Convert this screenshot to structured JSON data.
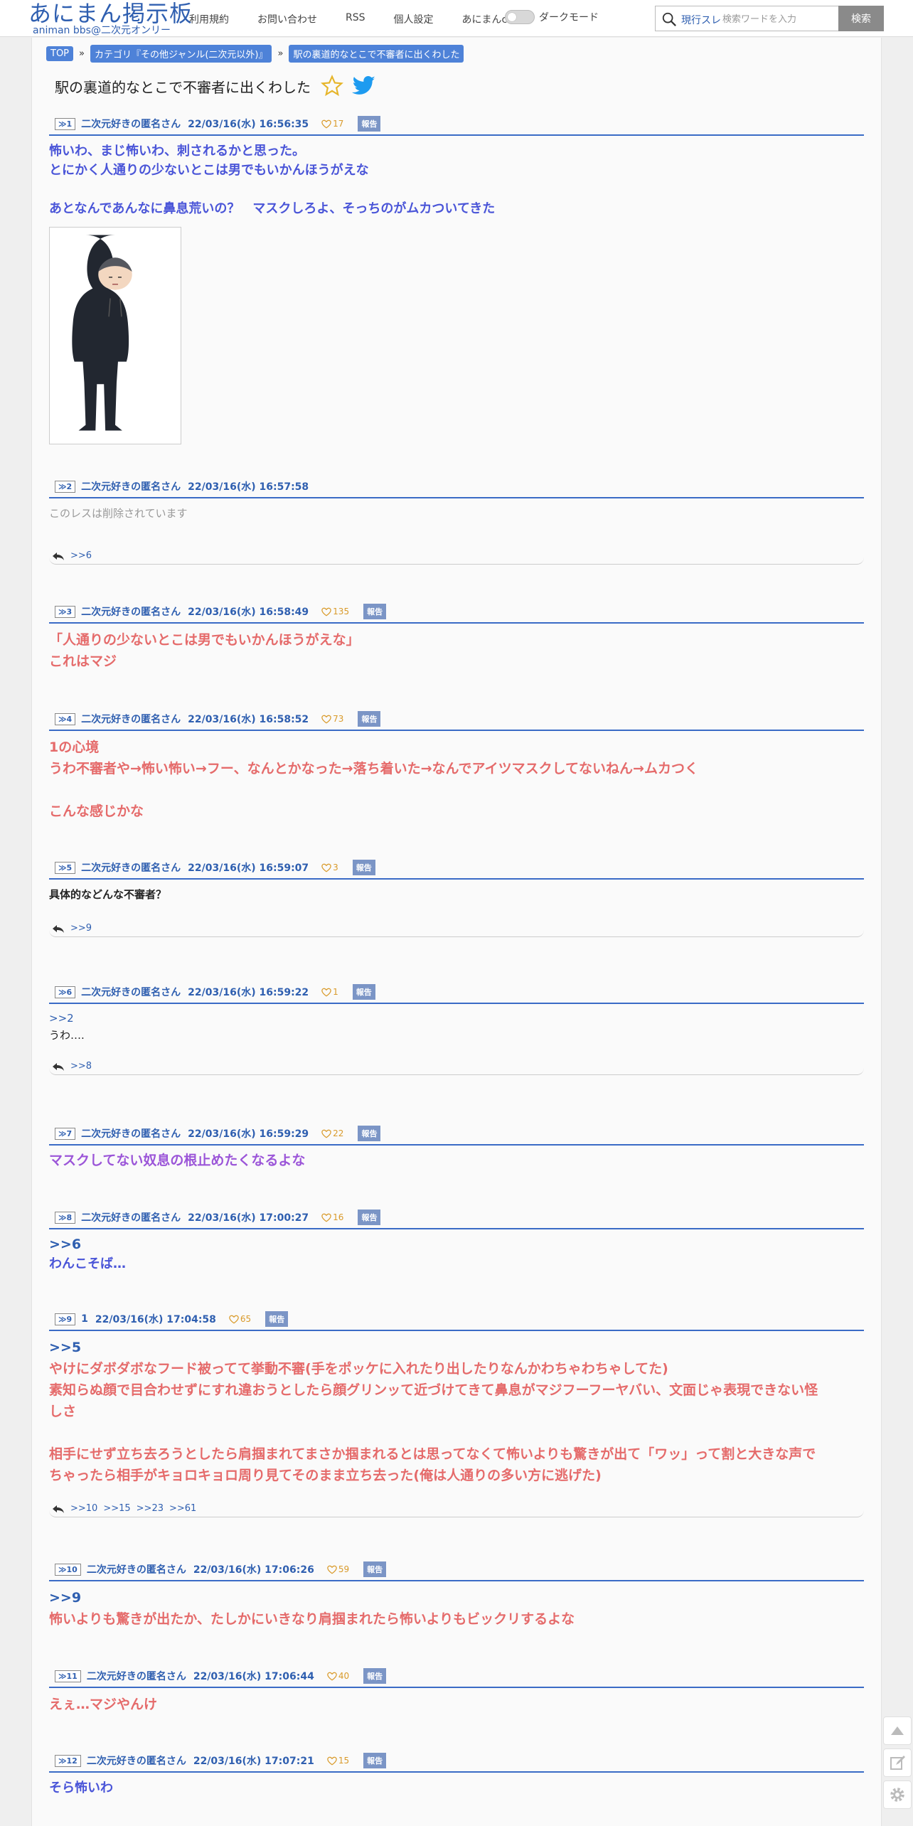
{
  "header": {
    "logo_main": "あにまん掲示板",
    "logo_sub": "animan bbs@二次元オンリー",
    "nav": [
      "利用規約",
      "お問い合わせ",
      "RSS",
      "個人設定",
      "あにまんch"
    ],
    "dark_mode_label": "ダークモード",
    "search_scope": "現行スレ",
    "search_placeholder": "検索ワードを入力",
    "search_button": "検索"
  },
  "breadcrumb": {
    "top": "TOP",
    "category": "カテゴリ『その他ジャンル(二次元以外)』",
    "thread": "駅の裏道的なとこで不審者に出くわした",
    "sep": "»"
  },
  "thread_title": "駅の裏道的なとこで不審者に出くわした",
  "report_label": "報告",
  "posts": [
    {
      "num": "1",
      "name": "二次元好きの匿名さん",
      "date": "22/03/16(水) 16:56:35",
      "likes": "17",
      "lines": [
        "怖いわ、まじ怖いわ、刺されるかと思った。",
        "とにかく人通りの少ないとこは男でもいかんほうがえな",
        "",
        "あとなんであんなに鼻息荒いの？　マスクしろよ、そっちのがムカついてきた"
      ]
    },
    {
      "num": "2",
      "name": "二次元好きの匿名さん",
      "date": "22/03/16(水) 16:57:58",
      "likes": "",
      "lines": [
        "このレスは削除されています"
      ],
      "replies": [
        ">>6"
      ]
    },
    {
      "num": "3",
      "name": "二次元好きの匿名さん",
      "date": "22/03/16(水) 16:58:49",
      "likes": "135",
      "lines": [
        "「人通りの少ないとこは男でもいかんほうがえな」",
        "これはマジ"
      ]
    },
    {
      "num": "4",
      "name": "二次元好きの匿名さん",
      "date": "22/03/16(水) 16:58:52",
      "likes": "73",
      "lines": [
        "1の心境",
        "うわ不審者や→怖い怖い→フー、なんとかなった→落ち着いた→なんでアイツマスクしてないねん→ムカつく",
        "",
        "こんな感じかな"
      ]
    },
    {
      "num": "5",
      "name": "二次元好きの匿名さん",
      "date": "22/03/16(水) 16:59:07",
      "likes": "3",
      "lines": [
        "具体的などんな不審者？"
      ],
      "replies": [
        ">>9"
      ]
    },
    {
      "num": "6",
      "name": "二次元好きの匿名さん",
      "date": "22/03/16(水) 16:59:22",
      "likes": "1",
      "anchor": ">>2",
      "lines": [
        "うわ…."
      ],
      "replies": [
        ">>8"
      ]
    },
    {
      "num": "7",
      "name": "二次元好きの匿名さん",
      "date": "22/03/16(水) 16:59:29",
      "likes": "22",
      "lines": [
        "マスクしてない奴息の根止めたくなるよな"
      ]
    },
    {
      "num": "8",
      "name": "二次元好きの匿名さん",
      "date": "22/03/16(水) 17:00:27",
      "likes": "16",
      "anchor": ">>6",
      "lines": [
        "わんこそば…"
      ]
    },
    {
      "num": "9",
      "name": "1",
      "date": "22/03/16(水) 17:04:58",
      "likes": "65",
      "anchor": ">>5",
      "lines": [
        "やけにダボダボなフード被ってて挙動不審(手をポッケに入れたり出したりなんかわちゃわちゃしてた)",
        "素知らぬ顔で目合わせずにすれ違おうとしたら顔グリンッて近づけてきて鼻息がマジフーフーヤバい、文面じゃ表現できない怪",
        "しさ",
        "",
        "相手にせず立ち去ろうとしたら肩掴まれてまさか掴まれるとは思ってなくて怖いよりも驚きが出て「ワッ」って割と大きな声で",
        "ちゃったら相手がキョロキョロ周り見てそのまま立ち去った(俺は人通りの多い方に逃げた)"
      ],
      "replies": [
        ">>10",
        ">>15",
        ">>23",
        ">>61"
      ]
    },
    {
      "num": "10",
      "name": "二次元好きの匿名さん",
      "date": "22/03/16(水) 17:06:26",
      "likes": "59",
      "anchor": ">>9",
      "lines": [
        "怖いよりも驚きが出たか、たしかにいきなり肩掴まれたら怖いよりもビックリするよな"
      ]
    },
    {
      "num": "11",
      "name": "二次元好きの匿名さん",
      "date": "22/03/16(水) 17:06:44",
      "likes": "40",
      "lines": [
        "えぇ…マジやんけ"
      ]
    },
    {
      "num": "12",
      "name": "二次元好きの匿名さん",
      "date": "22/03/16(水) 17:07:21",
      "likes": "15",
      "lines": [
        "そら怖いわ"
      ]
    }
  ]
}
